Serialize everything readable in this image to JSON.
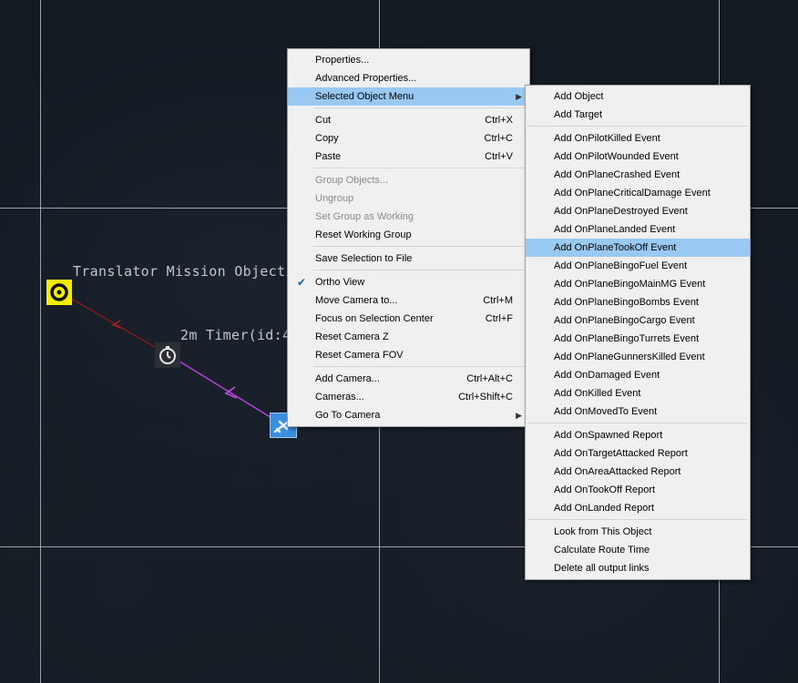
{
  "map": {
    "labels": {
      "translator": "Translator Mission Objecti",
      "timer": "2m Timer(id:4"
    },
    "colors": {
      "background": "#141a22",
      "objective_marker": "#f2ee00",
      "route_to_objective": "#8b1a1a",
      "route_from_plane": "#b040d8",
      "plane_marker": "#3a8ee0"
    }
  },
  "context_menu": {
    "items": [
      {
        "label": "Properties...",
        "shortcut": ""
      },
      {
        "label": "Advanced Properties...",
        "shortcut": ""
      },
      {
        "label": "Selected Object Menu",
        "shortcut": ""
      },
      {
        "label": "Cut",
        "shortcut": "Ctrl+X"
      },
      {
        "label": "Copy",
        "shortcut": "Ctrl+C"
      },
      {
        "label": "Paste",
        "shortcut": "Ctrl+V"
      },
      {
        "label": "Group Objects...",
        "shortcut": ""
      },
      {
        "label": "Ungroup",
        "shortcut": ""
      },
      {
        "label": "Set Group as Working",
        "shortcut": ""
      },
      {
        "label": "Reset Working Group",
        "shortcut": ""
      },
      {
        "label": "Save Selection to File",
        "shortcut": ""
      },
      {
        "label": "Ortho View",
        "shortcut": ""
      },
      {
        "label": "Move Camera to...",
        "shortcut": "Ctrl+M"
      },
      {
        "label": "Focus on Selection Center",
        "shortcut": "Ctrl+F"
      },
      {
        "label": "Reset Camera Z",
        "shortcut": ""
      },
      {
        "label": "Reset Camera FOV",
        "shortcut": ""
      },
      {
        "label": "Add Camera...",
        "shortcut": "Ctrl+Alt+C"
      },
      {
        "label": "Cameras...",
        "shortcut": "Ctrl+Shift+C"
      },
      {
        "label": "Go To Camera",
        "shortcut": ""
      }
    ]
  },
  "submenu": {
    "items": [
      "Add Object",
      "Add Target",
      "Add OnPilotKilled Event",
      "Add OnPilotWounded Event",
      "Add OnPlaneCrashed Event",
      "Add OnPlaneCriticalDamage Event",
      "Add OnPlaneDestroyed Event",
      "Add OnPlaneLanded Event",
      "Add OnPlaneTookOff Event",
      "Add OnPlaneBingoFuel Event",
      "Add OnPlaneBingoMainMG Event",
      "Add OnPlaneBingoBombs Event",
      "Add OnPlaneBingoCargo Event",
      "Add OnPlaneBingoTurrets Event",
      "Add OnPlaneGunnersKilled Event",
      "Add OnDamaged Event",
      "Add OnKilled Event",
      "Add OnMovedTo Event",
      "Add OnSpawned Report",
      "Add OnTargetAttacked Report",
      "Add OnAreaAttacked Report",
      "Add OnTookOff Report",
      "Add OnLanded Report",
      "Look from This Object",
      "Calculate Route Time",
      "Delete all output links"
    ],
    "highlight_color": "#99c9f2"
  }
}
